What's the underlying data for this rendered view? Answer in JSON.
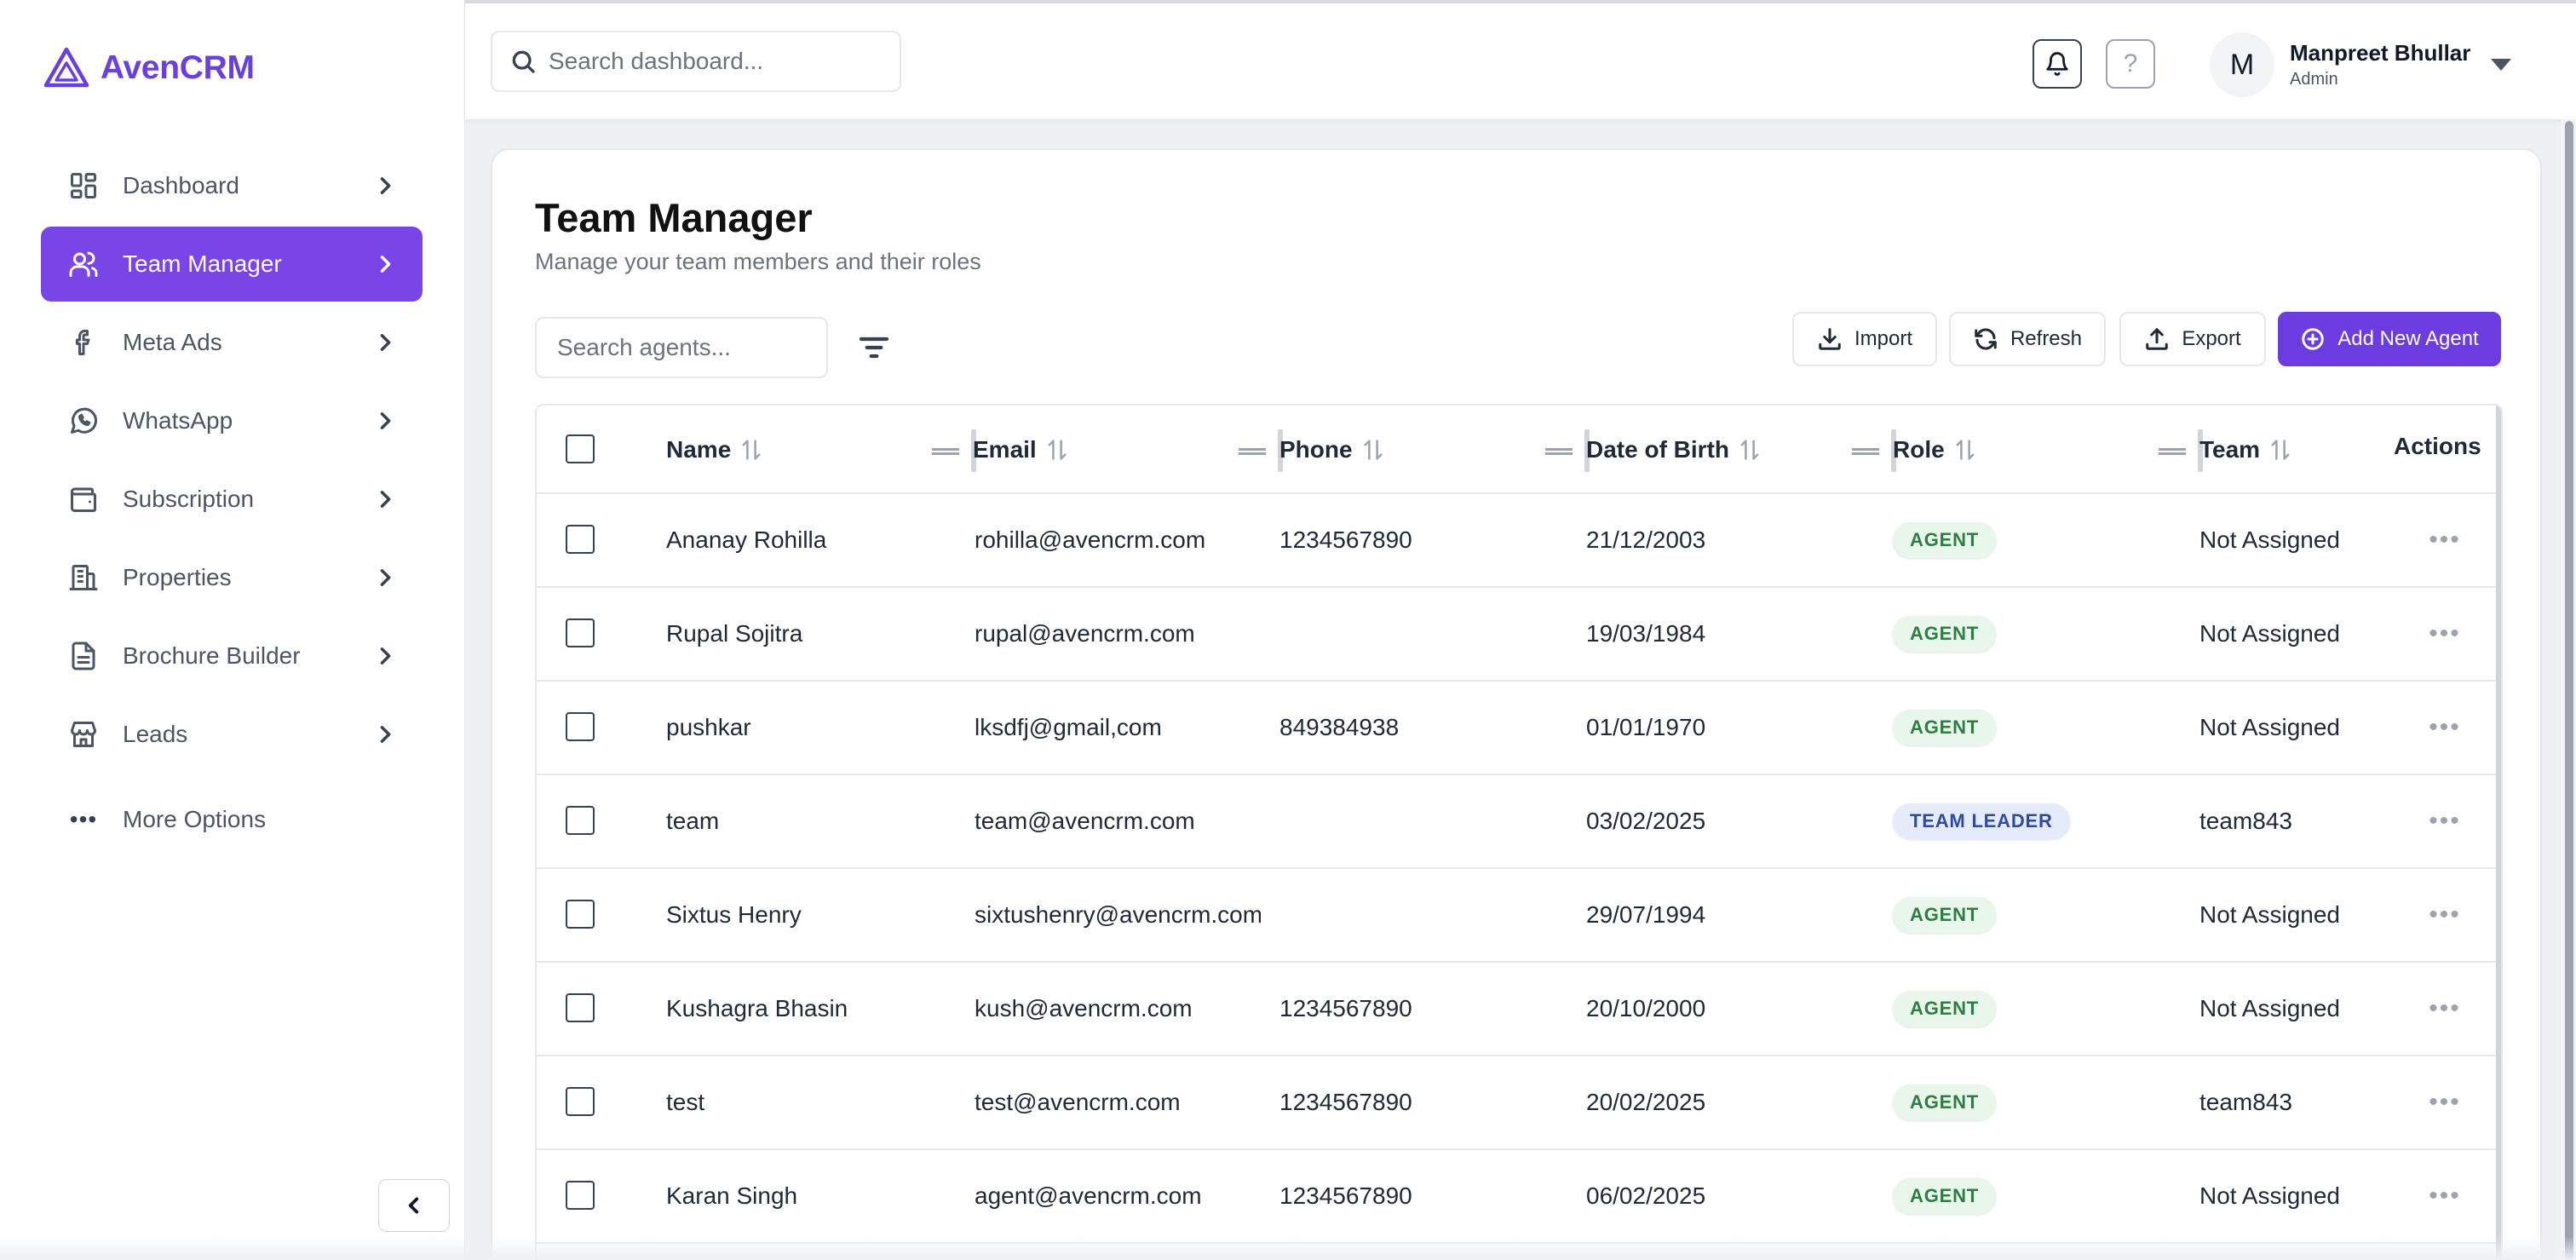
{
  "brand": {
    "name": "AvenCRM"
  },
  "colors": {
    "accent": "#7a45e6",
    "agent_badge": "#2e7d43",
    "leader_badge": "#2f4a9e"
  },
  "sidebar": {
    "items": [
      {
        "label": "Dashboard",
        "icon": "dashboard-grid-icon"
      },
      {
        "label": "Team Manager",
        "icon": "users-icon",
        "active": true
      },
      {
        "label": "Meta Ads",
        "icon": "facebook-icon"
      },
      {
        "label": "WhatsApp",
        "icon": "whatsapp-icon"
      },
      {
        "label": "Subscription",
        "icon": "wallet-icon"
      },
      {
        "label": "Properties",
        "icon": "building-icon"
      },
      {
        "label": "Brochure Builder",
        "icon": "document-icon"
      },
      {
        "label": "Leads",
        "icon": "store-icon"
      }
    ],
    "more_options": "More Options"
  },
  "topbar": {
    "search_placeholder": "Search dashboard...",
    "help_label": "?",
    "user": {
      "initial": "M",
      "name": "Manpreet Bhullar",
      "role": "Admin"
    }
  },
  "page": {
    "title": "Team Manager",
    "subtitle": "Manage your team members and their roles",
    "agent_search_placeholder": "Search agents...",
    "buttons": {
      "import": "Import",
      "refresh": "Refresh",
      "export": "Export",
      "add": "Add New Agent"
    }
  },
  "table": {
    "columns": [
      "Name",
      "Email",
      "Phone",
      "Date of Birth",
      "Role",
      "Team",
      "Actions"
    ],
    "rows": [
      {
        "name": "Ananay Rohilla",
        "email": "rohilla@avencrm.com",
        "phone": "1234567890",
        "dob": "21/12/2003",
        "role": "AGENT",
        "team": "Not Assigned"
      },
      {
        "name": "Rupal Sojitra",
        "email": "rupal@avencrm.com",
        "phone": "",
        "dob": "19/03/1984",
        "role": "AGENT",
        "team": "Not Assigned"
      },
      {
        "name": "pushkar",
        "email": "lksdfj@gmail,com",
        "phone": "849384938",
        "dob": "01/01/1970",
        "role": "AGENT",
        "team": "Not Assigned"
      },
      {
        "name": "team",
        "email": "team@avencrm.com",
        "phone": "",
        "dob": "03/02/2025",
        "role": "TEAM LEADER",
        "team": "team843"
      },
      {
        "name": "Sixtus Henry",
        "email": "sixtushenry@avencrm.com",
        "phone": "",
        "dob": "29/07/1994",
        "role": "AGENT",
        "team": "Not Assigned"
      },
      {
        "name": "Kushagra Bhasin",
        "email": "kush@avencrm.com",
        "phone": "1234567890",
        "dob": "20/10/2000",
        "role": "AGENT",
        "team": "Not Assigned"
      },
      {
        "name": "test",
        "email": "test@avencrm.com",
        "phone": "1234567890",
        "dob": "20/02/2025",
        "role": "AGENT",
        "team": "team843"
      },
      {
        "name": "Karan Singh",
        "email": "agent@avencrm.com",
        "phone": "1234567890",
        "dob": "06/02/2025",
        "role": "AGENT",
        "team": "Not Assigned"
      }
    ]
  }
}
